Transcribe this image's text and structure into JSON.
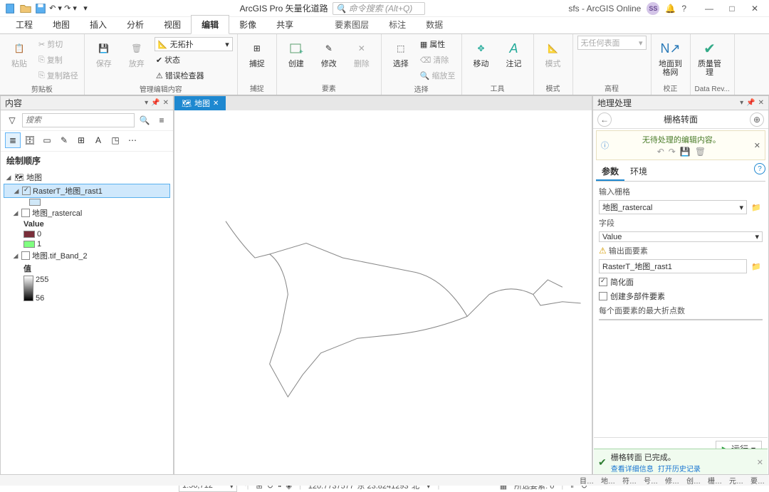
{
  "titlebar": {
    "app_title": "ArcGIS Pro 矢量化道路",
    "search_placeholder": "命令搜索 (Alt+Q)",
    "username": "sfs - ArcGIS Online",
    "user_initials": "SS"
  },
  "ribbon_tabs": [
    "工程",
    "地图",
    "插入",
    "分析",
    "视图",
    "编辑",
    "影像",
    "共享"
  ],
  "ribbon_context_tabs": [
    "要素图层",
    "标注",
    "数据"
  ],
  "ribbon_active_tab": "编辑",
  "ribbon": {
    "clipboard": {
      "label": "剪贴板",
      "paste": "粘贴",
      "cut": "剪切",
      "copy": "复制",
      "copypath": "复制路径"
    },
    "manage": {
      "label": "管理编辑内容",
      "save": "保存",
      "discard": "放弃",
      "topology_combo": "无拓扑",
      "status": "状态",
      "error_inspector": "错误检查器"
    },
    "snap": {
      "label": "捕捉",
      "snap": "捕捉"
    },
    "features": {
      "label": "要素",
      "create": "创建",
      "modify": "修改",
      "delete": "删除"
    },
    "selection": {
      "label": "选择",
      "select": "选择",
      "attributes": "属性",
      "clear": "清除",
      "zoomto": "缩放至"
    },
    "tools": {
      "label": "工具",
      "move": "移动",
      "annotate": "注记"
    },
    "mode": {
      "label": "模式",
      "mode": "模式"
    },
    "elevation": {
      "label": "高程",
      "placeholder": "无任何表面"
    },
    "correction": {
      "label": "校正",
      "ground": "地面到格网"
    },
    "datarev": {
      "label": "Data Rev...",
      "qm": "质量管理"
    }
  },
  "contents": {
    "title": "内容",
    "search_placeholder": "搜索",
    "section": "绘制顺序",
    "map_name": "地图",
    "layers": {
      "rast1": {
        "name": "RasterT_地图_rast1",
        "checked": true,
        "selected": true
      },
      "rastercal": {
        "name": "地图_rastercal",
        "checked": false,
        "legend_title": "Value",
        "classes": [
          {
            "label": "0",
            "color": "#7a2e3a"
          },
          {
            "label": "1",
            "color": "#7fff7f"
          }
        ]
      },
      "tif": {
        "name": "地图.tif_Band_2",
        "checked": false,
        "legend_title": "值",
        "max": "255",
        "min": "56"
      }
    }
  },
  "map": {
    "tab": "地图",
    "scale": "1:56,712",
    "coords": "120.7737577°东 23.8241293°北",
    "selected_label": "所选要素: 0"
  },
  "gp": {
    "title": "地理处理",
    "tool": "栅格转面",
    "pending_msg": "无待处理的编辑内容。",
    "tabs": [
      "参数",
      "环境"
    ],
    "active_tab": "参数",
    "input_raster_label": "输入栅格",
    "input_raster_value": "地图_rastercal",
    "field_label": "字段",
    "field_value": "Value",
    "output_label": "输出面要素",
    "output_value": "RasterT_地图_rast1",
    "simplify_label": "简化面",
    "simplify_checked": true,
    "multipart_label": "创建多部件要素",
    "multipart_checked": false,
    "maxvertex_label": "每个面要素的最大折点数",
    "run_label": "运行",
    "complete_msg": "栅格转面 已完成。",
    "detail_link": "查看详细信息",
    "history_link": "打开历史记录"
  },
  "statusbar_items": [
    "目…",
    "地…",
    "符…",
    "号…",
    "修…",
    "创…",
    "栅…",
    "元…",
    "要…"
  ]
}
